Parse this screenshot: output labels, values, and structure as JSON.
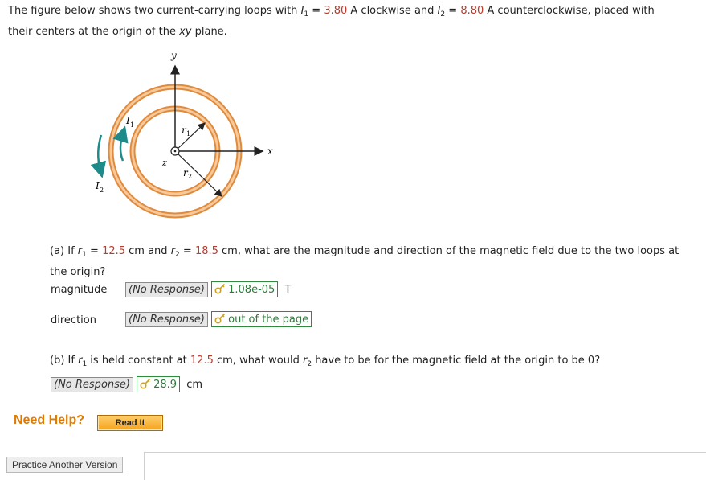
{
  "intro": {
    "part1": "The figure below shows two current-carrying loops with ",
    "i1_sym": "I",
    "i1_sub": "1",
    "eq1": " = ",
    "i1_val": "3.80",
    "i1_unit": " A clockwise and ",
    "i2_sym": "I",
    "i2_sub": "2",
    "eq2": " = ",
    "i2_val": "8.80",
    "i2_unit": " A counterclockwise, placed with",
    "line2a": "their centers at the origin of the ",
    "line2b": "xy",
    "line2c": " plane."
  },
  "figure": {
    "labels": {
      "y": "y",
      "x": "x",
      "z": "z",
      "I1": "I",
      "I1_sub": "1",
      "I2": "I",
      "I2_sub": "2",
      "r1": "r",
      "r1_sub": "1",
      "r2": "r",
      "r2_sub": "2"
    },
    "colors": {
      "loop": "#e08a3c",
      "loop_light": "#f6c89a",
      "arrow": "#1e8a8a"
    }
  },
  "partA": {
    "pre": "(a) If ",
    "r1": "r",
    "r1_sub": "1",
    "eq1": " = ",
    "r1_val": "12.5",
    "mid": " cm and ",
    "r2": "r",
    "r2_sub": "2",
    "eq2": " = ",
    "r2_val": "18.5",
    "post": " cm, what are the magnitude and direction of the magnetic field due to the two loops at",
    "line2": "the origin?",
    "magnitude_label": "magnitude",
    "magnitude_response": "(No Response)",
    "magnitude_answer": "1.08e-05",
    "magnitude_unit": "T",
    "direction_label": "direction",
    "direction_response": "(No Response)",
    "direction_answer": "out of the page"
  },
  "partB": {
    "pre": "(b) If ",
    "r1": "r",
    "r1_sub": "1",
    "mid1": " is held constant at ",
    "r1_val": "12.5",
    "mid2": " cm, what would ",
    "r2": "r",
    "r2_sub": "2",
    "post": " have to be for the magnetic field at the origin to be 0?",
    "response": "(No Response)",
    "answer": "28.9",
    "unit": "cm"
  },
  "help": {
    "need_help": "Need Help?",
    "read_it": "Read It"
  },
  "footer": {
    "practice": "Practice Another Version"
  }
}
